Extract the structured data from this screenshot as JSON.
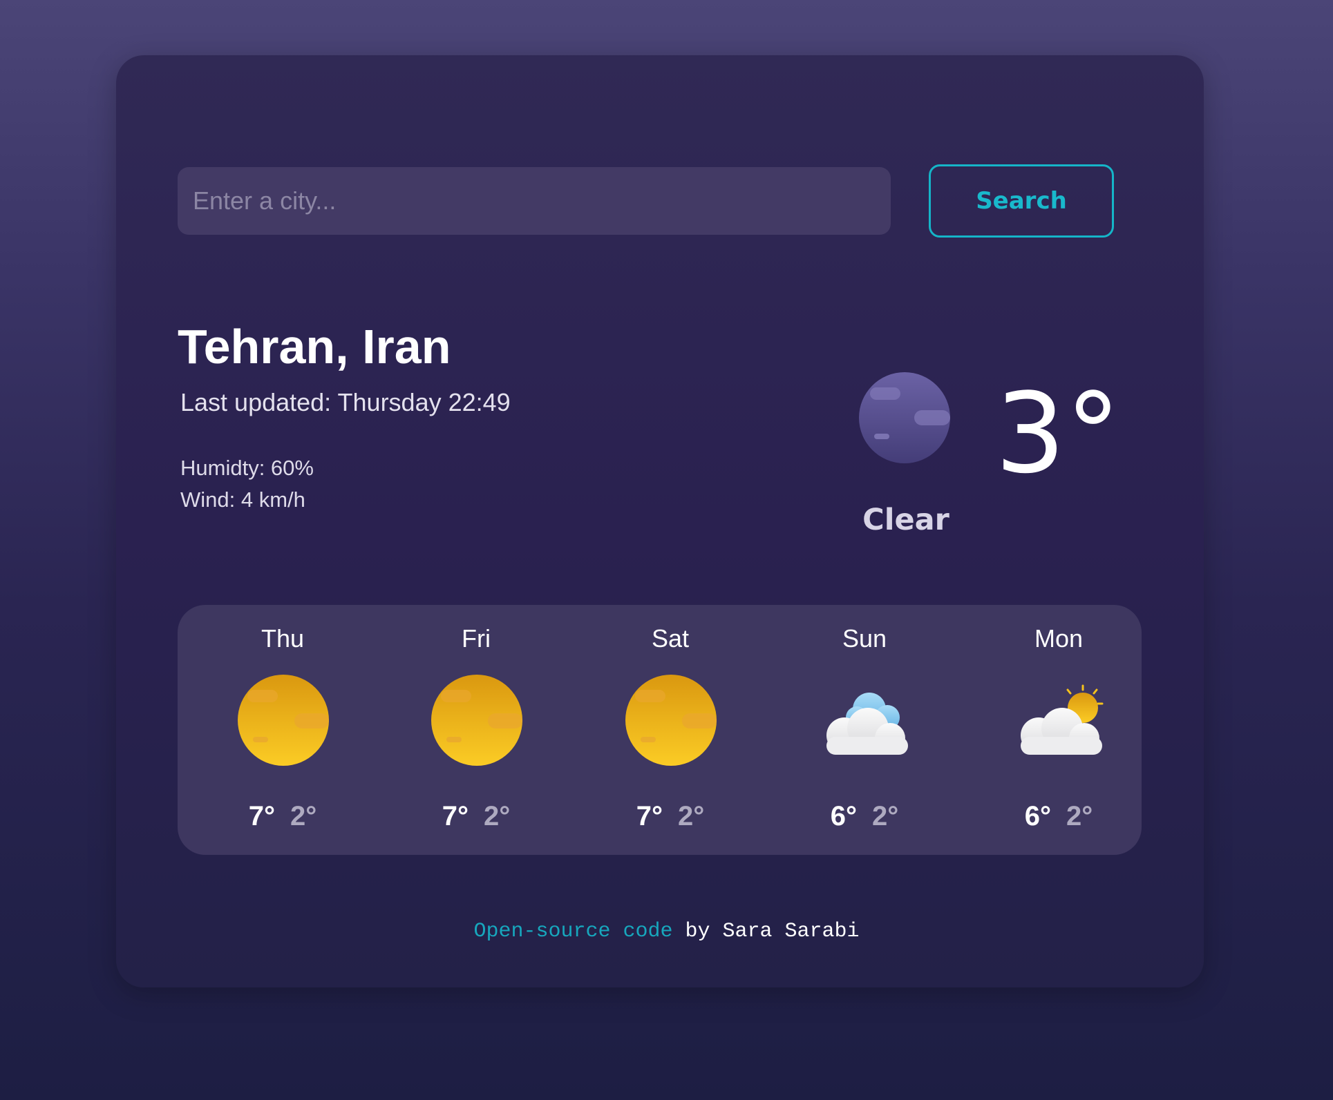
{
  "search": {
    "placeholder": "Enter a city...",
    "value": "",
    "button_label": "Search"
  },
  "current": {
    "city": "Tehran, Iran",
    "last_updated": "Last updated: Thursday 22:49",
    "humidity": "Humidty: 60%",
    "wind": "Wind: 4 km/h",
    "condition": "Clear",
    "temperature": "3°",
    "icon": "clear-night-icon"
  },
  "forecast": [
    {
      "day": "Thu",
      "max": "7°",
      "min": "2°",
      "icon": "sun-icon"
    },
    {
      "day": "Fri",
      "max": "7°",
      "min": "2°",
      "icon": "sun-icon"
    },
    {
      "day": "Sat",
      "max": "7°",
      "min": "2°",
      "icon": "sun-icon"
    },
    {
      "day": "Sun",
      "max": "6°",
      "min": "2°",
      "icon": "cloudy-icon"
    },
    {
      "day": "Mon",
      "max": "6°",
      "min": "2°",
      "icon": "partly-cloudy-icon"
    }
  ],
  "footer": {
    "link_text": "Open-source code",
    "credit": " by Sara Sarabi"
  },
  "colors": {
    "accent": "#15b5c8",
    "sun": "#f5c21c",
    "moon": "#5c5494",
    "card": "#2a2150",
    "forecast_panel": "#3e3760"
  }
}
